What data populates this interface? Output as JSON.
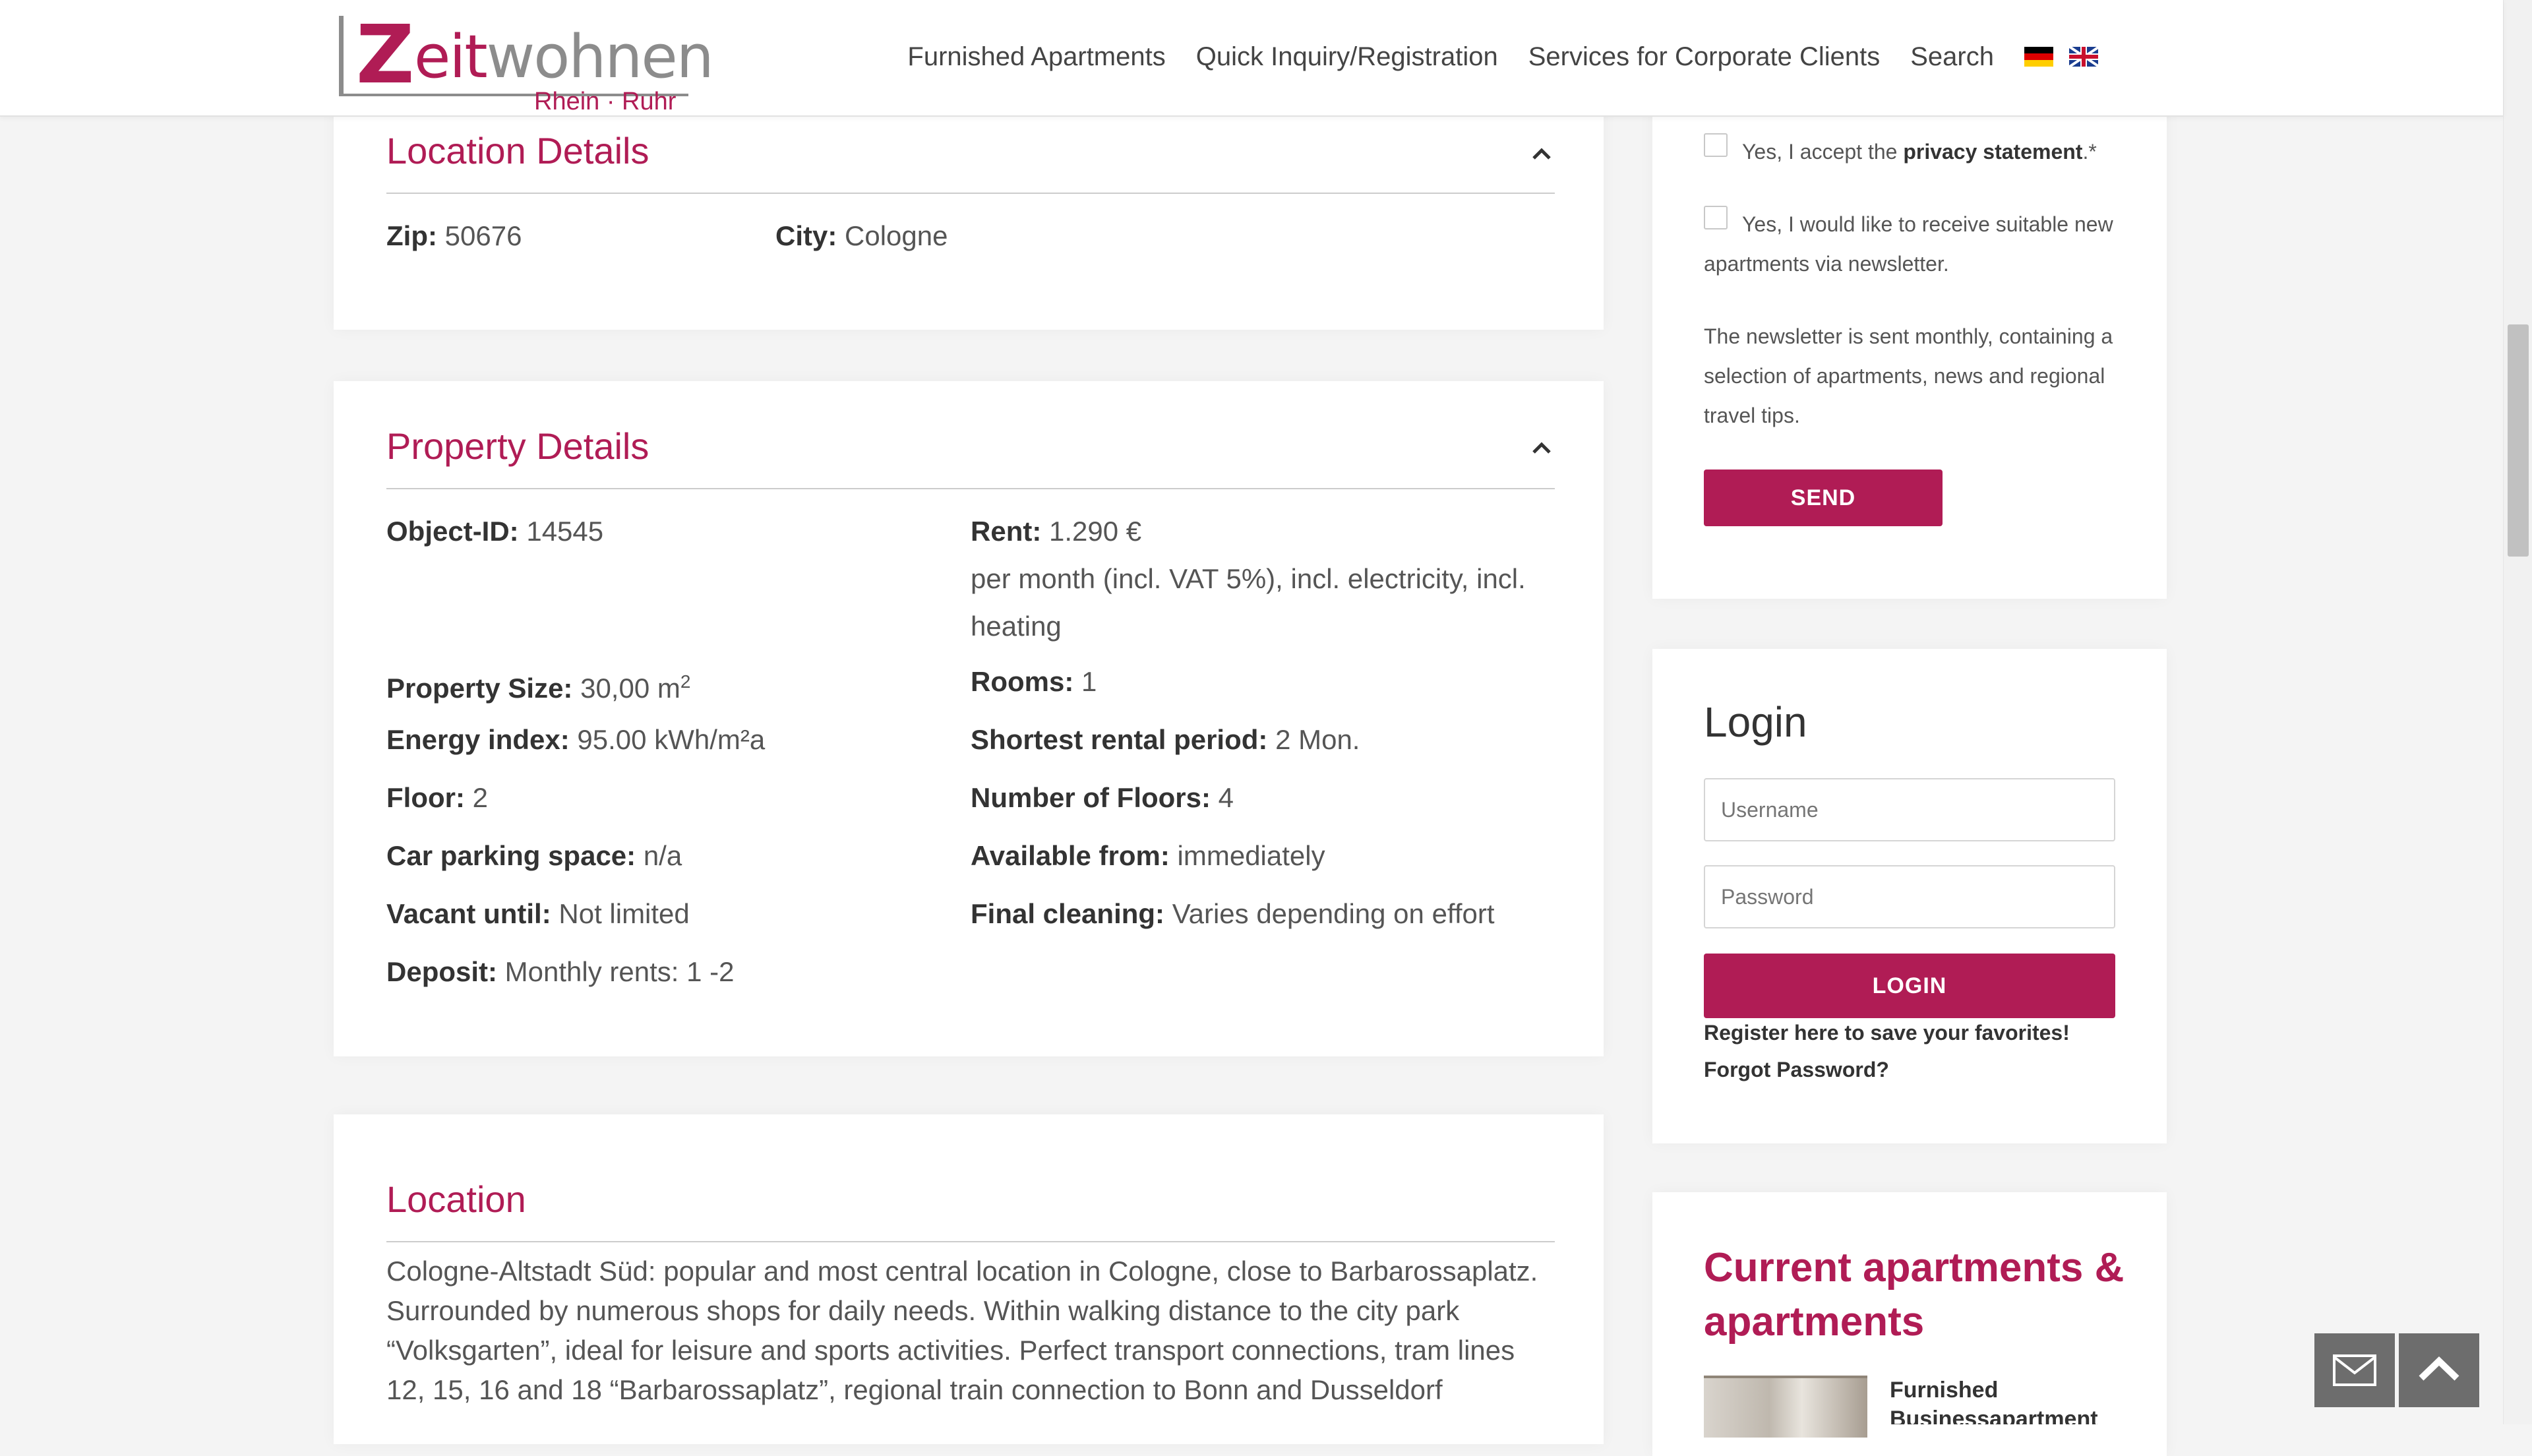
{
  "header": {
    "logo": {
      "initial": "Z",
      "part_red": "eit",
      "part_grey": "wohnen",
      "subline": "Rhein · Ruhr"
    },
    "nav": [
      {
        "label": "Furnished Apartments"
      },
      {
        "label": "Quick Inquiry/Registration"
      },
      {
        "label": "Services for Corporate Clients"
      },
      {
        "label": "Search"
      }
    ],
    "flags": [
      "german-flag-icon",
      "english-flag-icon"
    ]
  },
  "location_details": {
    "title": "Location Details",
    "zip_label": "Zip:",
    "zip_value": "50676",
    "city_label": "City:",
    "city_value": "Cologne"
  },
  "property_details": {
    "title": "Property Details",
    "left": [
      {
        "label": "Object-ID:",
        "value": "14545"
      },
      {
        "label": "Property Size:",
        "value": "30,00 m",
        "sup": "2"
      },
      {
        "label": "Energy index:",
        "value": "95.00 kWh/m²a"
      },
      {
        "label": "Floor:",
        "value": "2"
      },
      {
        "label": "Car parking space:",
        "value": "n/a"
      },
      {
        "label": "Vacant until:",
        "value": "Not limited"
      },
      {
        "label": "Deposit:",
        "value": "Monthly rents: 1 -2"
      }
    ],
    "right": [
      {
        "label": "Rent:",
        "value": "1.290 €",
        "note": "per month (incl. VAT 5%), incl. electricity, incl. heating"
      },
      {
        "label": "Rooms:",
        "value": "1"
      },
      {
        "label": "Shortest rental period:",
        "value": "2 Mon."
      },
      {
        "label": "Number of Floors:",
        "value": "4"
      },
      {
        "label": "Available from:",
        "value": "immediately"
      },
      {
        "label": "Final cleaning:",
        "value": "Varies depending on effort"
      }
    ]
  },
  "location": {
    "title": "Location",
    "text": "Cologne-Altstadt Süd: popular and most central location in Cologne, close to Barbarossaplatz. Surrounded by numerous shops for daily needs. Within walking distance to the city park “Volksgarten”, ideal for leisure and sports activities. Perfect transport connections, tram lines 12, 15, 16 and 18 “Barbarossaplatz”, regional train connection to Bonn and Dusseldorf"
  },
  "inquiry_form": {
    "privacy_prefix": "Yes, I accept the ",
    "privacy_link": "privacy statement",
    "privacy_suffix": ".*",
    "newsletter_label": "Yes, I would like to receive suitable new apartments via newsletter.",
    "newsletter_info": "The newsletter is sent monthly, containing a selection of apartments, news and regional travel tips.",
    "send_label": "SEND"
  },
  "login": {
    "title": "Login",
    "username_placeholder": "Username",
    "password_placeholder": "Password",
    "login_label": "LOGIN",
    "register_link": "Register here to save your favorites!",
    "forgot_link": "Forgot Password?"
  },
  "current_apartments": {
    "title": "Current apartments & apartments",
    "first_item_title": "Furnished Businessapartment"
  },
  "floating": {
    "mail_icon": "mail-icon",
    "up_icon": "chevron-up-icon"
  },
  "colors": {
    "accent": "#b01c55",
    "text": "#333333",
    "muted": "#8c8c8c"
  }
}
